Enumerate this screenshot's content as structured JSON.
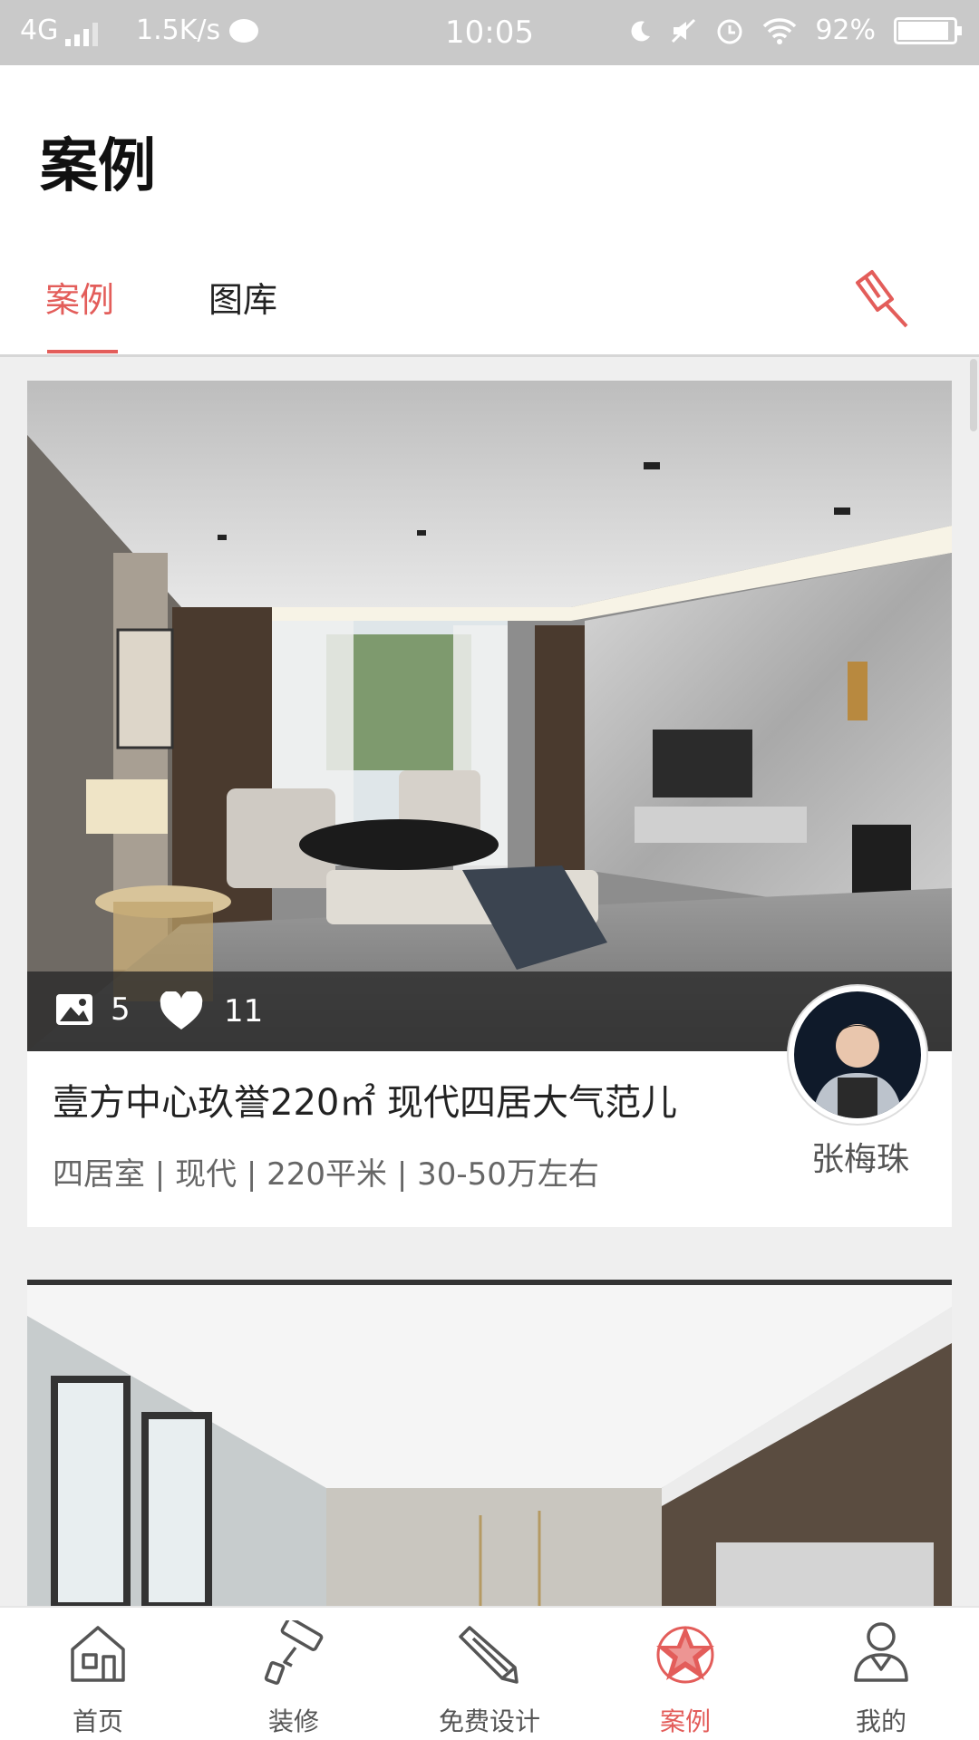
{
  "status_bar": {
    "network": "4G",
    "speed": "1.5K/s",
    "time": "10:05",
    "battery": "92%",
    "battery_level": 0.92,
    "icons": [
      "signal-icon",
      "chat-icon",
      "moon-icon",
      "mute-icon",
      "alarm-icon",
      "wifi-icon",
      "battery-icon"
    ]
  },
  "header": {
    "title": "案例",
    "tabs": [
      {
        "label": "案例",
        "active": true
      },
      {
        "label": "图库",
        "active": false
      }
    ],
    "action_icon": "brush-icon"
  },
  "cases": [
    {
      "photo_count": "5",
      "likes": "11",
      "title": "壹方中心玖誉220㎡ 现代四居大气范儿",
      "tags": "四居室 | 现代 | 220平米 | 30-50万左右",
      "designer": "张梅珠"
    }
  ],
  "bottom_nav": [
    {
      "label": "首页",
      "icon": "home-icon",
      "active": false
    },
    {
      "label": "装修",
      "icon": "paint-roller-icon",
      "active": false
    },
    {
      "label": "免费设计",
      "icon": "pencil-icon",
      "active": false
    },
    {
      "label": "案例",
      "icon": "star-icon",
      "active": true
    },
    {
      "label": "我的",
      "icon": "profile-icon",
      "active": false
    }
  ],
  "colors": {
    "accent": "#e35d5a",
    "status_bar": "#c9c9c9",
    "background": "#efefef"
  }
}
